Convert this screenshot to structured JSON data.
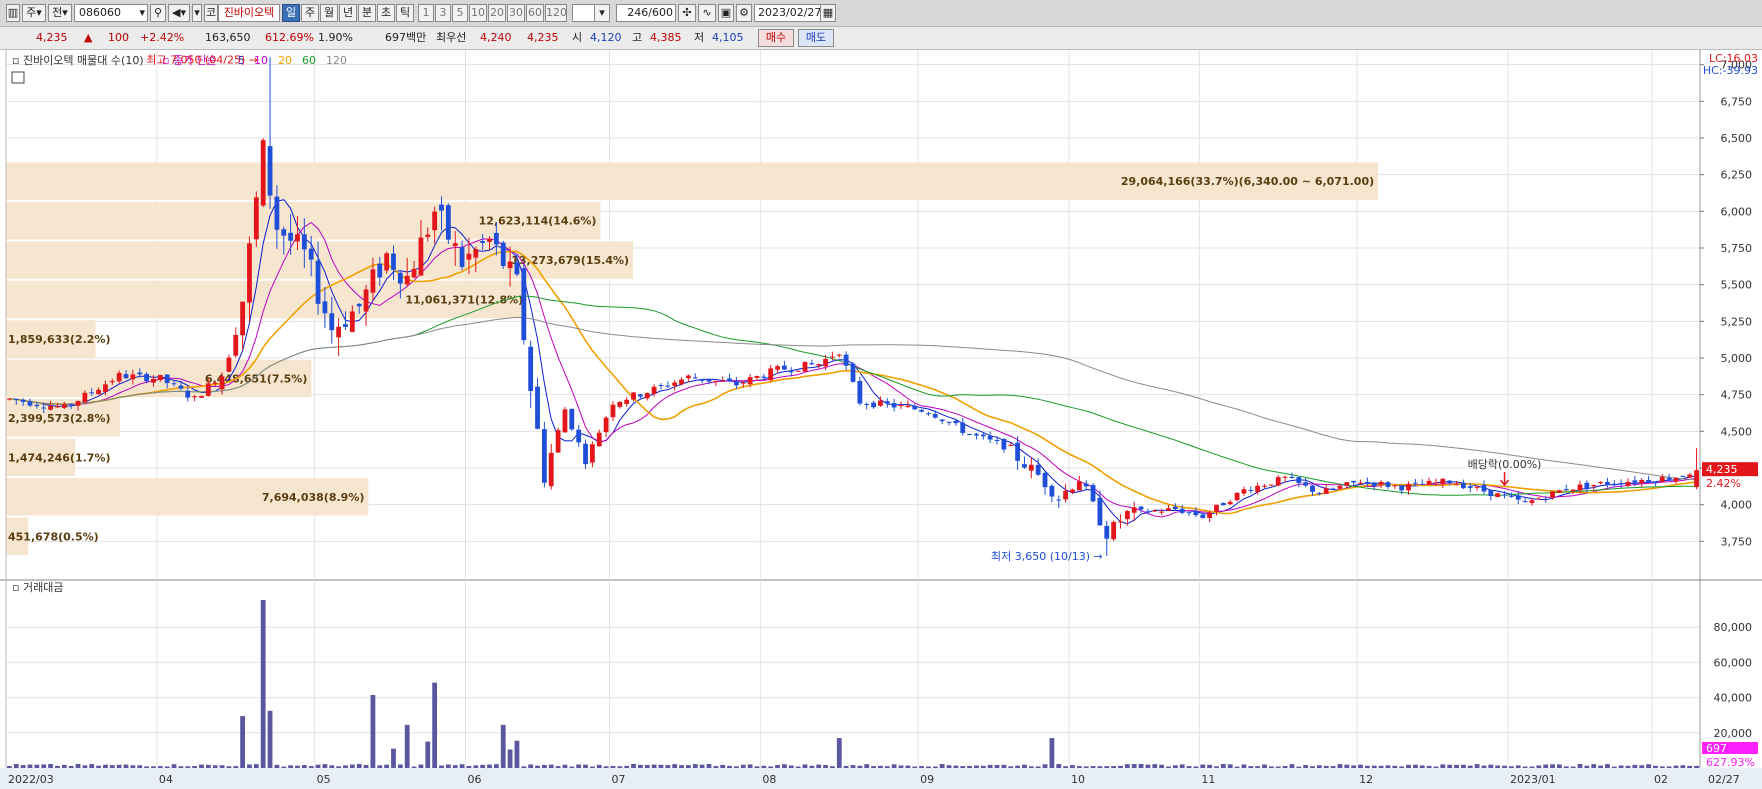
{
  "toolbar": {
    "type_label": "주",
    "mode_label": "전",
    "code": "086060",
    "market_label": "코",
    "stock_name": "진바이오텍",
    "periods": [
      "일",
      "주",
      "월",
      "년",
      "분",
      "초",
      "틱"
    ],
    "active_period": "일",
    "intervals": [
      "1",
      "3",
      "5",
      "10",
      "20",
      "30",
      "60",
      "120"
    ],
    "count": "246",
    "count_total": "/600",
    "date": "2023/02/27"
  },
  "quote": {
    "price": "4,235",
    "arrow": "▲",
    "change": "100",
    "change_pct": "+2.42%",
    "volume": "163,650",
    "volume_ratio": "612.69%",
    "turnover": "1.90%",
    "amount": "697백만",
    "best_label": "최우선",
    "ask": "4,240",
    "bid": "4,235",
    "open_label": "시",
    "open": "4,120",
    "high_label": "고",
    "high": "4,385",
    "low_label": "저",
    "low": "4,105",
    "buy_label": "매수",
    "sell_label": "매도"
  },
  "colors": {
    "up": "#e3171b",
    "down": "#1f4fd8",
    "ma5": "#0a1ed0",
    "ma10": "#c000c0",
    "ma20": "#f0a000",
    "ma60": "#1a9a2a",
    "ma120": "#8a8a8a",
    "profile": "#f7e6cf",
    "volume": "#5a56a0"
  },
  "chart_data": [
    {
      "type": "candlestick",
      "title": "진바이오텍 매물대 수(10)",
      "ma_title": "종가 단순",
      "ma_periods": [
        "5",
        "10",
        "20",
        "60",
        "120"
      ],
      "ylim": [
        3500,
        7100
      ],
      "yticks": [
        3750,
        4000,
        4250,
        4500,
        4750,
        5000,
        5250,
        5500,
        5750,
        6000,
        6250,
        6500,
        6750,
        7000
      ],
      "ytick_labels": [
        "3,750",
        "4,000",
        "4,250",
        "4,500",
        "4,750",
        "5,000",
        "5,250",
        "5,500",
        "5,750",
        "6,000",
        "6,250",
        "6,500",
        "6,750",
        "7,000"
      ],
      "x_labels": [
        "2022/03",
        "04",
        "05",
        "06",
        "07",
        "08",
        "09",
        "10",
        "11",
        "12",
        "2023/01",
        "02",
        "02/27"
      ],
      "x_label_days": [
        0,
        22,
        45,
        67,
        88,
        110,
        133,
        155,
        174,
        197,
        219,
        240,
        246
      ],
      "lc_label": "LC:16.03",
      "hc_label": "HC:-39.93",
      "last_price_label": "4,235",
      "last_change_label": "2.42%",
      "high_annotation": "최고 7,050 (04/25)",
      "low_annotation": "최저 3,650 (10/13)",
      "dividend_annotation": "배당락(0.00%)",
      "annotation_points": {
        "high": [
          38,
          7050
        ],
        "low": [
          160,
          3650
        ],
        "dividend": [
          218,
          4100
        ]
      },
      "volume_profile": [
        {
          "label": "29,064,166(33.7%)(6,340.00 ~ 6,071.00)",
          "pct": 33.7,
          "low": 6071,
          "high": 6340
        },
        {
          "label": "12,623,114(14.6%)",
          "pct": 14.6,
          "low": 5802,
          "high": 6071
        },
        {
          "label": "13,273,679(15.4%)",
          "pct": 15.4,
          "low": 5533,
          "high": 5802
        },
        {
          "label": "11,061,371(12.8%)",
          "pct": 12.8,
          "low": 5264,
          "high": 5533
        },
        {
          "label": "1,859,633(2.2%)",
          "pct": 2.2,
          "low": 4995,
          "high": 5264
        },
        {
          "label": "6,448,651(7.5%)",
          "pct": 7.5,
          "low": 4726,
          "high": 4995
        },
        {
          "label": "2,399,573(2.8%)",
          "pct": 2.8,
          "low": 4457,
          "high": 4726
        },
        {
          "label": "1,474,246(1.7%)",
          "pct": 1.7,
          "low": 4188,
          "high": 4457
        },
        {
          "label": "7,694,038(8.9%)",
          "pct": 8.9,
          "low": 3919,
          "high": 4188
        },
        {
          "label": "451,678(0.5%)",
          "pct": 0.5,
          "low": 3650,
          "high": 3919
        }
      ]
    },
    {
      "type": "bar",
      "title": "거래대금",
      "ylim": [
        0,
        100000
      ],
      "yticks": [
        20000,
        40000,
        60000,
        80000
      ],
      "ytick_labels": [
        "20,000",
        "40,000",
        "60,000",
        "80,000"
      ],
      "last_value_label": "697",
      "last_ratio_label": "627.93%",
      "spikes": [
        [
          34,
          29500
        ],
        [
          37,
          95500
        ],
        [
          38,
          32500
        ],
        [
          53,
          41500
        ],
        [
          56,
          11000
        ],
        [
          58,
          24500
        ],
        [
          61,
          15000
        ],
        [
          62,
          48500
        ],
        [
          72,
          24500
        ],
        [
          73,
          10500
        ],
        [
          74,
          15500
        ],
        [
          121,
          17000
        ],
        [
          152,
          17000
        ]
      ]
    }
  ]
}
